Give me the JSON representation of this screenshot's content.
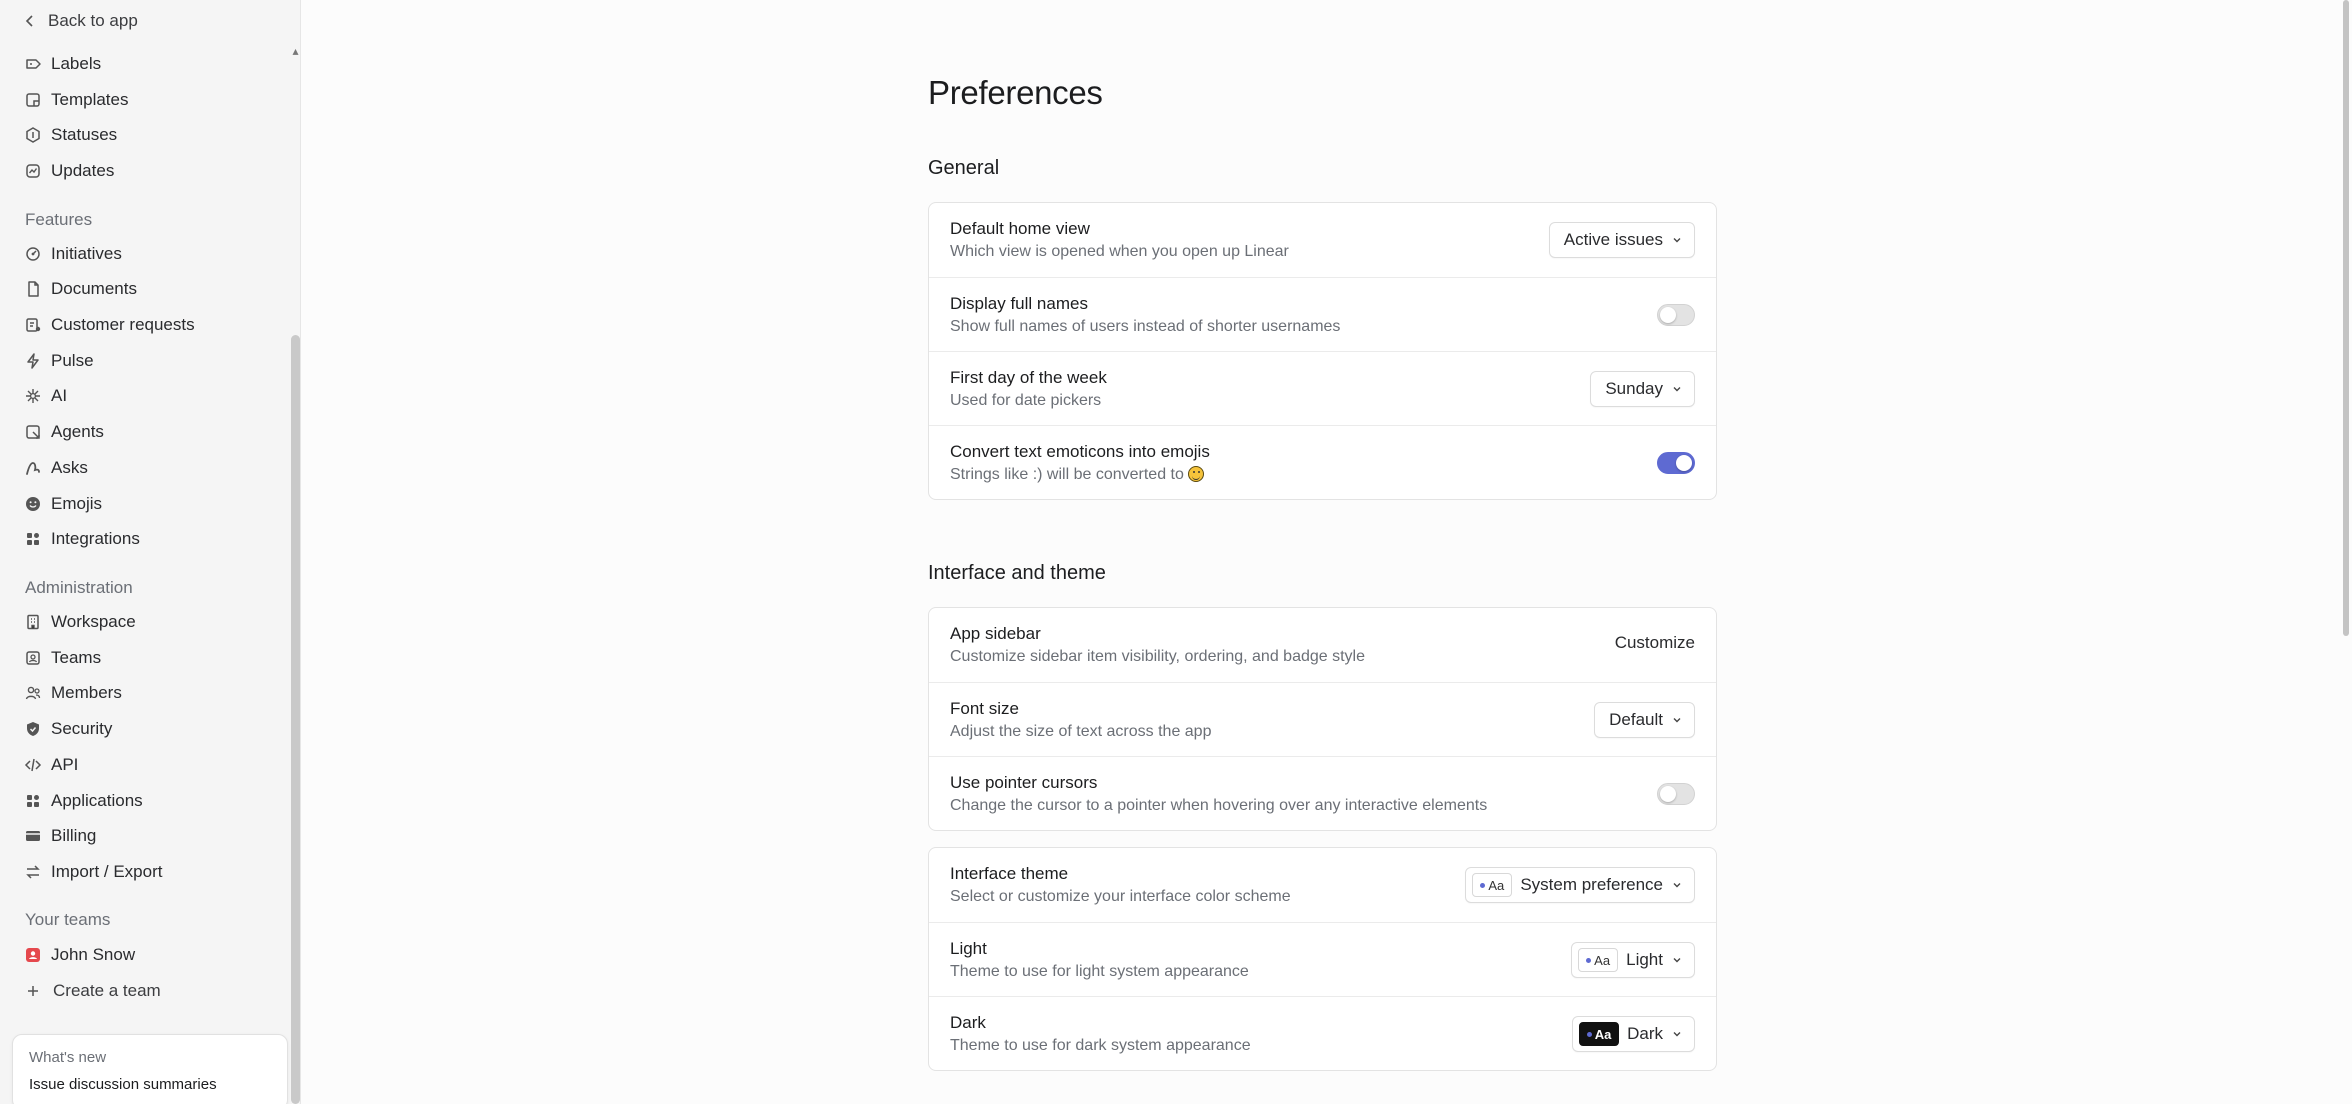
{
  "sidebar": {
    "back_label": "Back to app",
    "items_top": [
      {
        "label": "Labels",
        "icon": "label-icon"
      },
      {
        "label": "Templates",
        "icon": "template-icon"
      },
      {
        "label": "Statuses",
        "icon": "status-icon"
      },
      {
        "label": "Updates",
        "icon": "updates-icon"
      }
    ],
    "features_heading": "Features",
    "features": [
      {
        "label": "Initiatives",
        "icon": "initiatives-icon"
      },
      {
        "label": "Documents",
        "icon": "document-icon"
      },
      {
        "label": "Customer requests",
        "icon": "customer-requests-icon"
      },
      {
        "label": "Pulse",
        "icon": "pulse-icon"
      },
      {
        "label": "AI",
        "icon": "sparkle-icon"
      },
      {
        "label": "Agents",
        "icon": "agents-icon"
      },
      {
        "label": "Asks",
        "icon": "asks-icon"
      },
      {
        "label": "Emojis",
        "icon": "emoji-icon"
      },
      {
        "label": "Integrations",
        "icon": "integrations-icon"
      }
    ],
    "admin_heading": "Administration",
    "admin": [
      {
        "label": "Workspace",
        "icon": "workspace-icon"
      },
      {
        "label": "Teams",
        "icon": "teams-icon"
      },
      {
        "label": "Members",
        "icon": "members-icon"
      },
      {
        "label": "Security",
        "icon": "shield-icon"
      },
      {
        "label": "API",
        "icon": "code-icon"
      },
      {
        "label": "Applications",
        "icon": "applications-icon"
      },
      {
        "label": "Billing",
        "icon": "billing-icon"
      },
      {
        "label": "Import / Export",
        "icon": "import-export-icon"
      }
    ],
    "teams_heading": "Your teams",
    "team_name": "John Snow",
    "create_team_label": "Create a team",
    "whats_new": {
      "label": "What's new",
      "title": "Issue discussion summaries"
    }
  },
  "main": {
    "title": "Preferences",
    "general": {
      "heading": "General",
      "default_home_view": {
        "label": "Default home view",
        "desc": "Which view is opened when you open up Linear",
        "value": "Active issues"
      },
      "display_full_names": {
        "label": "Display full names",
        "desc": "Show full names of users instead of shorter usernames",
        "enabled": false
      },
      "first_day": {
        "label": "First day of the week",
        "desc": "Used for date pickers",
        "value": "Sunday"
      },
      "emoticons": {
        "label": "Convert text emoticons into emojis",
        "desc": "Strings like :) will be converted to",
        "enabled": true
      }
    },
    "interface": {
      "heading": "Interface and theme",
      "app_sidebar": {
        "label": "App sidebar",
        "desc": "Customize sidebar item visibility, ordering, and badge style",
        "action": "Customize"
      },
      "font_size": {
        "label": "Font size",
        "desc": "Adjust the size of text across the app",
        "value": "Default"
      },
      "pointer": {
        "label": "Use pointer cursors",
        "desc": "Change the cursor to a pointer when hovering over any interactive elements",
        "enabled": false
      },
      "theme": {
        "label": "Interface theme",
        "desc": "Select or customize your interface color scheme",
        "value": "System preference",
        "swatch": "Aa"
      },
      "light": {
        "label": "Light",
        "desc": "Theme to use for light system appearance",
        "value": "Light",
        "swatch": "Aa"
      },
      "dark": {
        "label": "Dark",
        "desc": "Theme to use for dark system appearance",
        "value": "Dark",
        "swatch": "Aa"
      }
    }
  },
  "colors": {
    "accent": "#5e6ad2",
    "team_icon": "#e5484d"
  }
}
